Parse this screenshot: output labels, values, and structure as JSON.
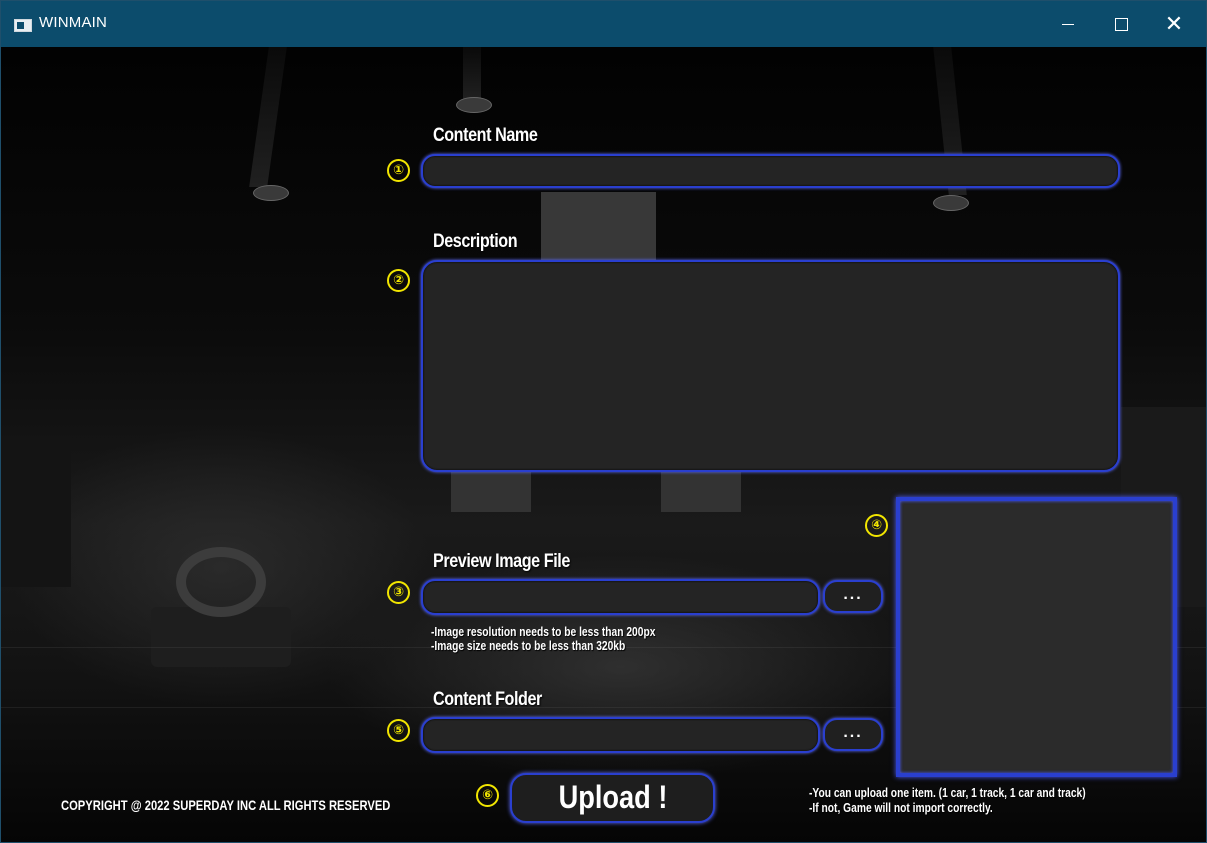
{
  "window": {
    "title": "WINMAIN",
    "controls": {
      "minimize": "minimize-icon",
      "maximize": "maximize-icon",
      "close": "close-icon"
    }
  },
  "form": {
    "content_name": {
      "number": "①",
      "label": "Content Name",
      "value": ""
    },
    "description": {
      "number": "②",
      "label": "Description",
      "value": ""
    },
    "preview_image": {
      "number": "③",
      "label": "Preview Image File",
      "value": "",
      "browse_label": "...",
      "notes": [
        "-Image resolution needs to be less than 200px",
        "-Image size needs to be less than 320kb"
      ]
    },
    "preview_box": {
      "number": "④"
    },
    "content_folder": {
      "number": "⑤",
      "label": "Content Folder",
      "value": "",
      "browse_label": "..."
    },
    "upload": {
      "number": "⑥",
      "label": "Upload !"
    }
  },
  "footer": {
    "copyright": "COPYRIGHT @ 2022 SUPERDAY INC ALL RIGHTS RESERVED",
    "notes": [
      "-You can upload one item. (1 car, 1 track, 1 car and track)",
      "-If not, Game will not import correctly."
    ]
  },
  "colors": {
    "titlebar": "#0c4c6c",
    "accent_border": "#2a3fcf",
    "marker": "#f2e600",
    "field_bg": "#242424"
  }
}
